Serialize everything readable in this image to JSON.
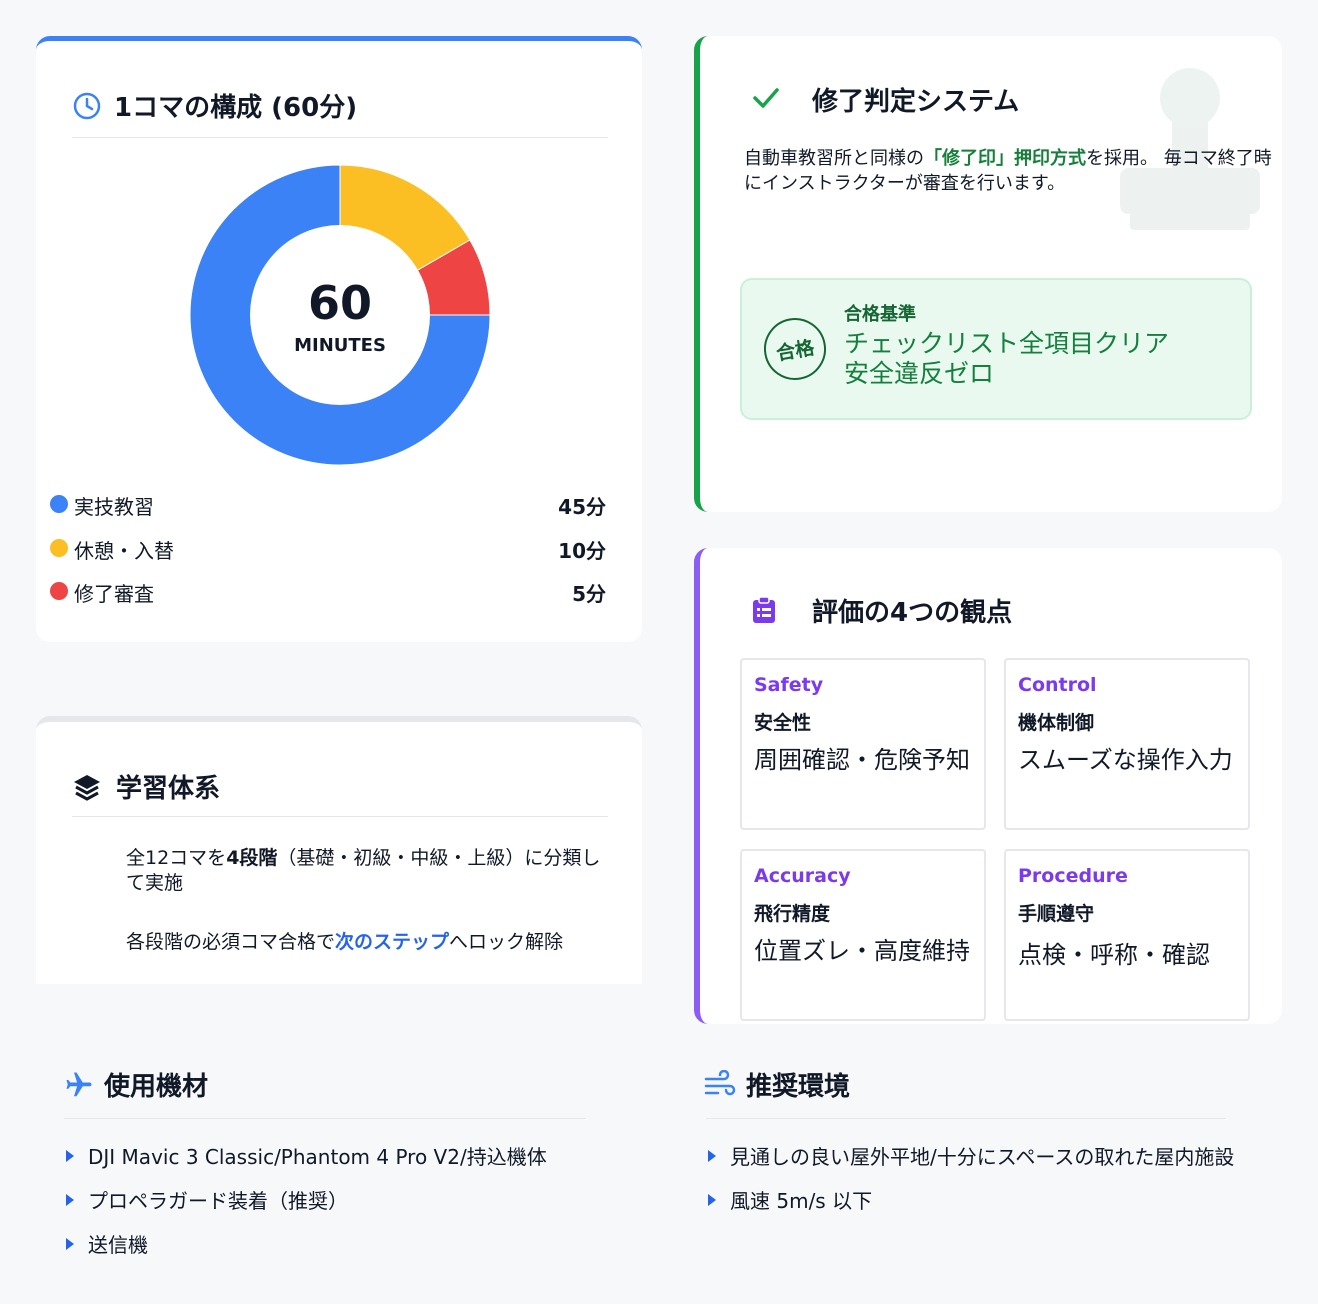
{
  "composition": {
    "title": "1コマの構成 (60分)",
    "center_value": "60",
    "center_unit": "MINUTES",
    "legend": [
      {
        "label": "実技教習",
        "value": "45分",
        "color": "#3b82f6"
      },
      {
        "label": "休憩・入替",
        "value": "10分",
        "color": "#fbbf24"
      },
      {
        "label": "修了審査",
        "value": "5分",
        "color": "#ef4444"
      }
    ]
  },
  "chart_data": {
    "type": "pie",
    "categories": [
      "実技教習",
      "休憩・入替",
      "修了審査"
    ],
    "values": [
      45,
      10,
      5
    ],
    "unit": "分",
    "colors": [
      "#3b82f6",
      "#fbbf24",
      "#ef4444"
    ],
    "donut": true
  },
  "judgement": {
    "title": "修了判定システム",
    "desc_pre": "自動車教習所と同様の",
    "desc_highlight": "「修了印」押印方式",
    "desc_post": "を採用。 毎コマ終了時にインストラクターが審査を行います。",
    "stamp": "合格",
    "criteria_title": "合格基準",
    "criteria_lines": [
      "チェックリスト全項目クリア",
      "安全違反ゼロ"
    ]
  },
  "learning": {
    "title": "学習体系",
    "line1_pre": "全12コマを",
    "line1_bold": "4段階",
    "line1_post": "（基礎・初級・中級・上級）に分類して実施",
    "line2_pre": "各段階の必須コマ合格で",
    "line2_link": "次のステップ",
    "line2_post": "へロック解除"
  },
  "evaluation": {
    "title": "評価の4つの観点",
    "items": [
      {
        "en": "Safety",
        "jp": "安全性",
        "desc": "周囲確認・危険予知"
      },
      {
        "en": "Control",
        "jp": "機体制御",
        "desc": "スムーズな操作入力"
      },
      {
        "en": "Accuracy",
        "jp": "飛行精度",
        "desc": "位置ズレ・高度維持"
      },
      {
        "en": "Procedure",
        "jp": "手順遵守",
        "desc": "点検・呼称・確認"
      }
    ]
  },
  "equipment": {
    "title": "使用機材",
    "items": [
      "DJI Mavic 3 Classic/Phantom 4 Pro V2/持込機体",
      "プロペラガード装着（推奨）",
      "送信機"
    ]
  },
  "environment": {
    "title": "推奨環境",
    "items": [
      "見通しの良い屋外平地/十分にスペースの取れた屋内施設",
      "風速 5m/s 以下"
    ]
  }
}
